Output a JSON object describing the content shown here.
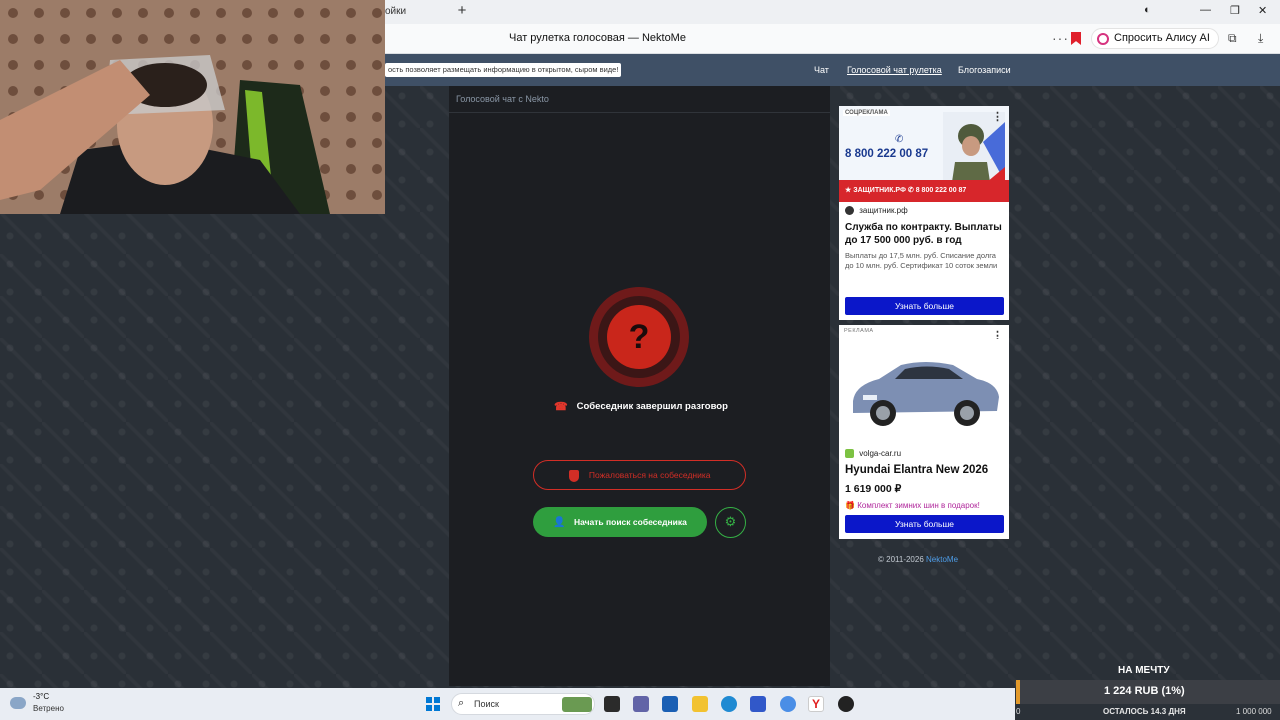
{
  "browser": {
    "tab_fragment": "ойки",
    "page_title": "Чат рулетка голосовая — NektoMe",
    "alice_label": "Спросить Алису AI"
  },
  "site": {
    "notice": "ость позволяет размещать информацию в открытом, сыром виде!",
    "nav": {
      "chat": "Чат",
      "voice": "Голосовой чат рулетка",
      "blog": "Блогозаписи"
    }
  },
  "chat": {
    "header": "Голосовой чат с Nekto",
    "status_icon": "?",
    "status_text": "Собеседник завершил разговор",
    "report_label": "Пожаловаться на собеседника",
    "search_label": "Начать поиск собеседника"
  },
  "ads": [
    {
      "badge": "СОЦРЕКЛАМА",
      "banner_phone": "8 800 222 00 87",
      "banner_strip": "★ ЗАЩИТНИК.РФ  ✆ 8 800 222 00 87",
      "domain": "защитник.рф",
      "headline": "Служба по контракту. Выплаты до 17 500 000 руб. в год",
      "description": "Выплаты до 17,5 млн. руб. Списание долга до 10 млн. руб. Сертификат 10 соток земли",
      "cta": "Узнать больше"
    },
    {
      "badge": "РЕКЛАМА",
      "domain": "volga-car.ru",
      "headline": "Hyundai Elantra New 2026",
      "price": "1 619 000 ₽",
      "promo": "Комплект зимних шин в подарок!",
      "cta": "Узнать больше"
    }
  ],
  "footer": {
    "copyright": "© 2011-2026 ",
    "brand": "NektoMe"
  },
  "stream_goal": {
    "title": "НА МЕЧТУ",
    "amount": "1 224 RUB (1%)",
    "remaining": "ОСТАЛОСЬ 14.3 ДНЯ",
    "start": "0",
    "goal": "1 000 000"
  },
  "taskbar": {
    "temperature": "-3°C",
    "weather": "Ветрено",
    "search_placeholder": "Поиск"
  },
  "colors": {
    "accent_red": "#d22e26",
    "accent_green": "#2f9e3e",
    "nav_bg": "#3f5066",
    "cta_blue": "#0b17c9"
  }
}
